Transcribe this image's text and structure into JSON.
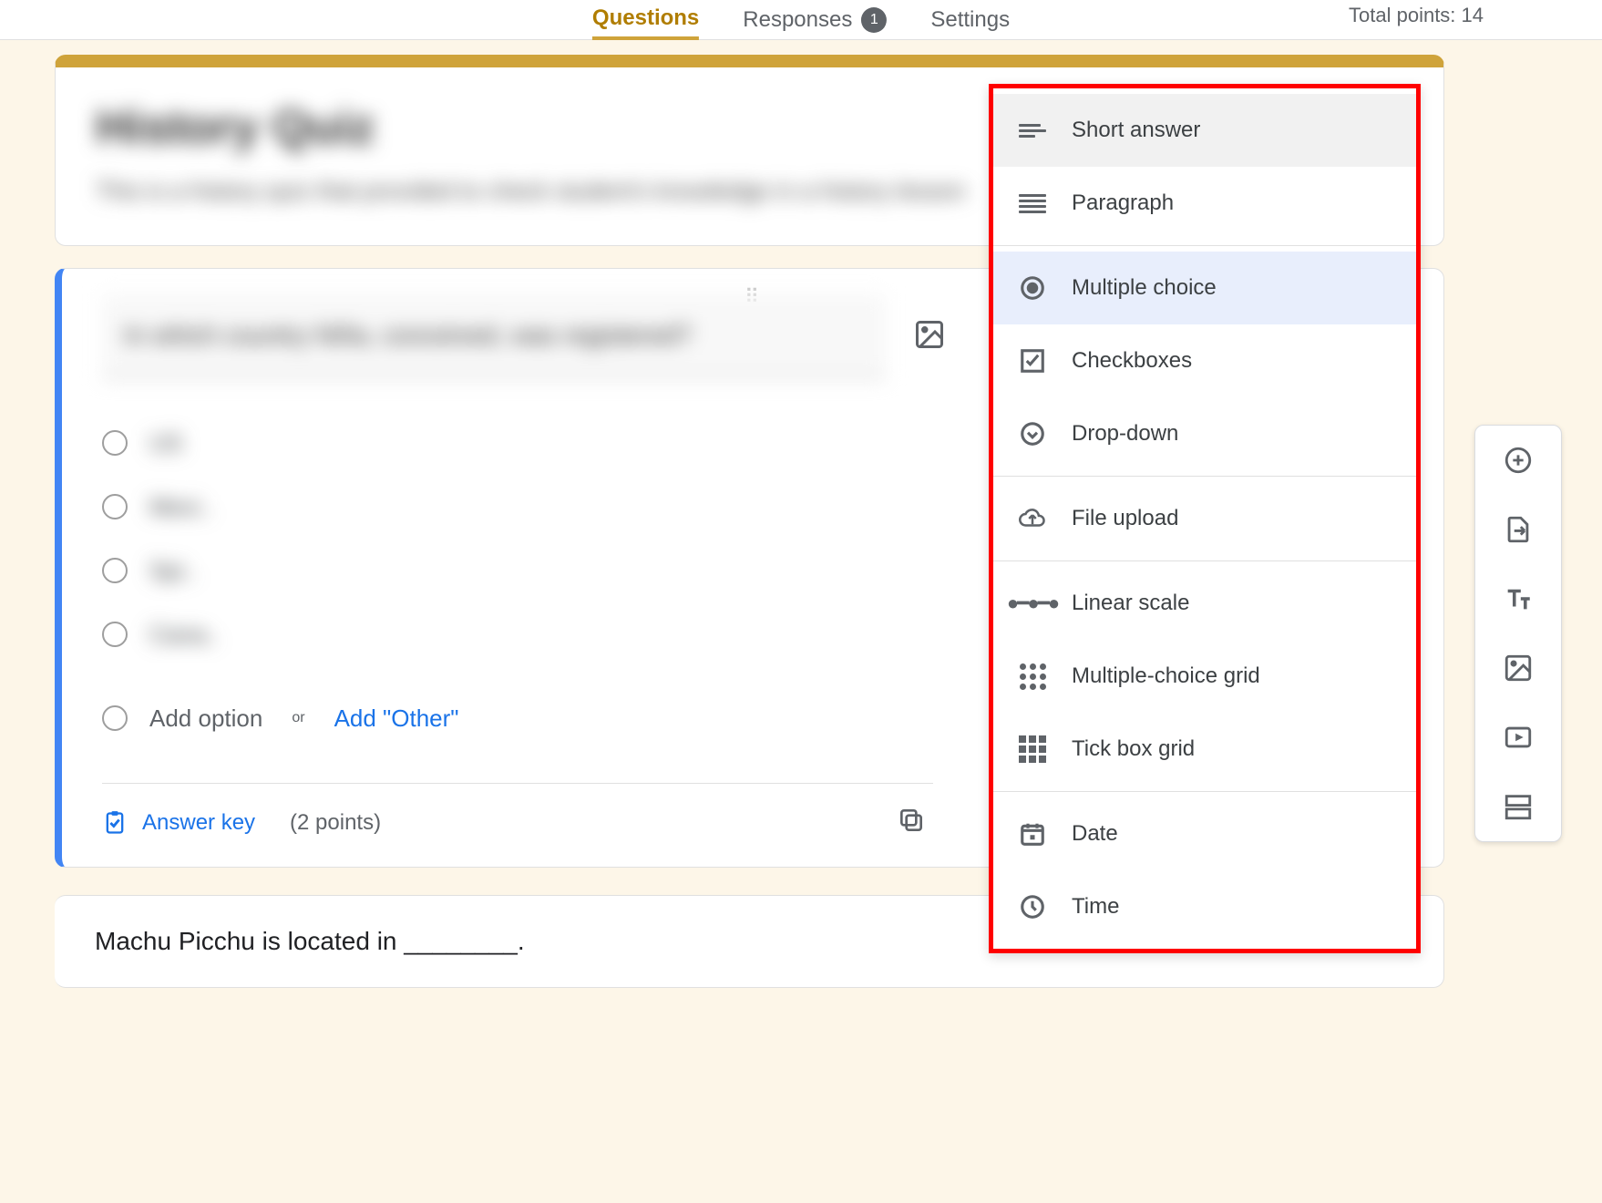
{
  "top": {
    "tabs": {
      "questions": "Questions",
      "responses": "Responses",
      "responses_badge": "1",
      "settings": "Settings"
    },
    "total_points": "Total points: 14"
  },
  "form": {
    "title": "History Quiz",
    "description": "This is a history quiz that provided to check student's knowledge in a history lesson"
  },
  "question": {
    "text": "In which country Niña, conceived, was registered?",
    "options": [
      "US",
      "Mexi..",
      "Spi..",
      "Cana.."
    ],
    "add_option": "Add option",
    "or": "or",
    "add_other": "Add \"Other\"",
    "answer_key": "Answer key",
    "points": "(2 points)"
  },
  "next_question": {
    "text": "Machu Picchu is located in ________."
  },
  "dropdown": {
    "items": [
      {
        "key": "short_answer",
        "label": "Short answer"
      },
      {
        "key": "paragraph",
        "label": "Paragraph"
      },
      {
        "key": "multiple_choice",
        "label": "Multiple choice"
      },
      {
        "key": "checkboxes",
        "label": "Checkboxes"
      },
      {
        "key": "drop_down",
        "label": "Drop-down"
      },
      {
        "key": "file_upload",
        "label": "File upload"
      },
      {
        "key": "linear_scale",
        "label": "Linear scale"
      },
      {
        "key": "mc_grid",
        "label": "Multiple-choice grid"
      },
      {
        "key": "tick_grid",
        "label": "Tick box grid"
      },
      {
        "key": "date",
        "label": "Date"
      },
      {
        "key": "time",
        "label": "Time"
      }
    ],
    "hovered": "short_answer",
    "selected": "multiple_choice"
  },
  "colors": {
    "theme": "#cfa33a",
    "accent": "#1a73e8",
    "highlight_border": "#ff0000"
  }
}
